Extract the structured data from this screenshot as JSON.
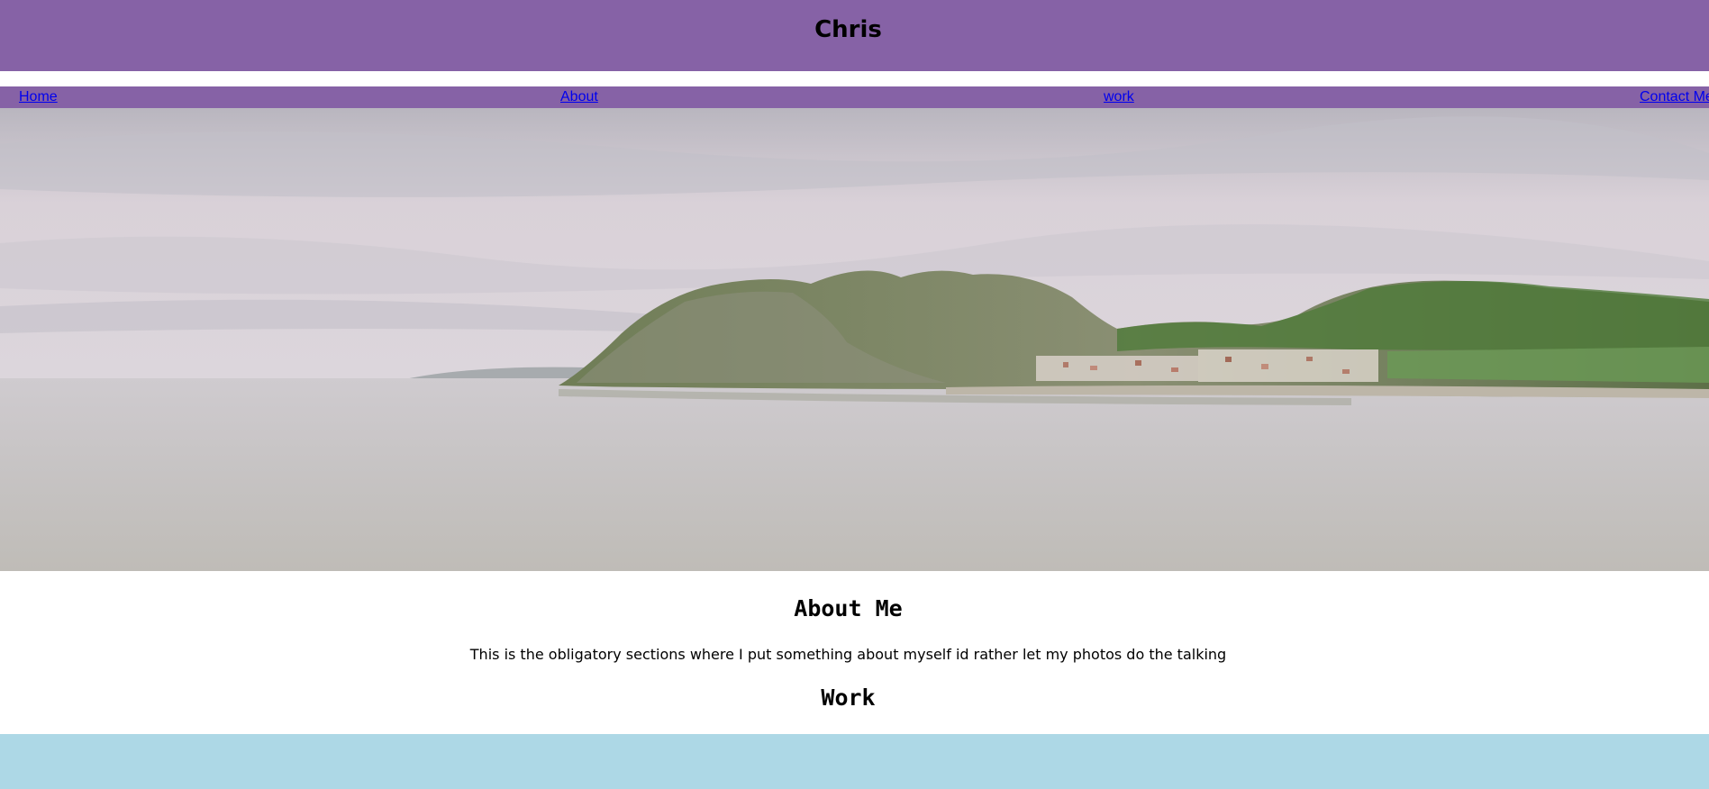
{
  "header": {
    "title": "Chris",
    "background_color": "#8662a6"
  },
  "nav": {
    "background_color": "#8662a6",
    "link_color": "#0000ee",
    "items": [
      {
        "label": "Home"
      },
      {
        "label": "About"
      },
      {
        "label": "work"
      },
      {
        "label": "Contact Me"
      }
    ]
  },
  "hero": {
    "image_subject": "coastal landscape photo: overcast sky, green headland with a small seaside town, calm grey sea"
  },
  "about": {
    "heading": "About Me",
    "text": "This is the obligatory sections where I put something about myself id rather let my photos do the talking"
  },
  "work": {
    "heading": "Work"
  },
  "footer": {
    "background_color": "#add8e6"
  }
}
